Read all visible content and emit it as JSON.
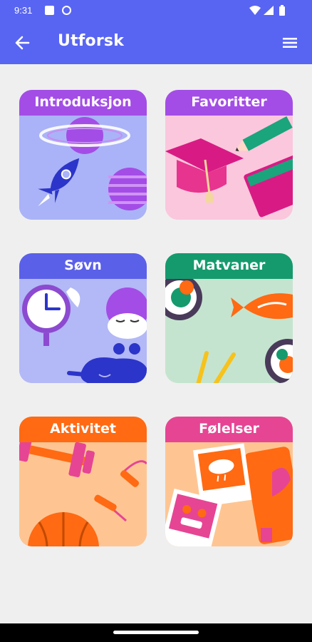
{
  "status_bar": {
    "time": "9:31",
    "icons": [
      "notification-square-icon",
      "sync-circle-icon",
      "wifi-icon",
      "cellular-signal-icon",
      "battery-icon"
    ]
  },
  "app_bar": {
    "title": "Utforsk",
    "back_icon": "arrow-left-icon",
    "menu_icon": "hamburger-menu-icon",
    "color": "#5865f2"
  },
  "categories": [
    {
      "label": "Introduksjon",
      "header_color": "#a34de6",
      "bg_color": "#aab3f7"
    },
    {
      "label": "Favoritter",
      "header_color": "#a34de6",
      "bg_color": "#fbc7dd"
    },
    {
      "label": "Søvn",
      "header_color": "#5b60e8",
      "bg_color": "#b3b8f6"
    },
    {
      "label": "Matvaner",
      "header_color": "#159a6e",
      "bg_color": "#c5e4cf"
    },
    {
      "label": "Aktivitet",
      "header_color": "#ff6a13",
      "bg_color": "#fec593"
    },
    {
      "label": "Følelser",
      "header_color": "#e64594",
      "bg_color": "#fec593"
    }
  ]
}
